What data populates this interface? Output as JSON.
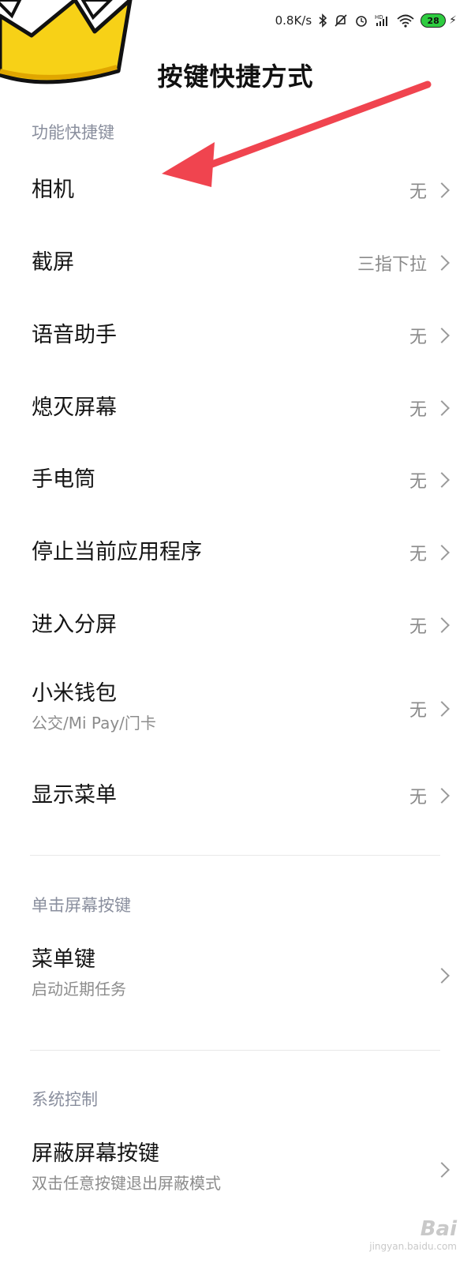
{
  "status_bar": {
    "net_speed": "0.8K/s",
    "battery": "28",
    "icons": [
      "bluetooth-icon",
      "mute-icon",
      "alarm-icon",
      "hd-signal-icon",
      "wifi-icon",
      "battery-icon",
      "charging-icon"
    ]
  },
  "page": {
    "title": "按键快捷方式"
  },
  "sections": [
    {
      "header": "功能快捷键",
      "items": [
        {
          "label": "相机",
          "value": "无"
        },
        {
          "label": "截屏",
          "value": "三指下拉"
        },
        {
          "label": "语音助手",
          "value": "无"
        },
        {
          "label": "熄灭屏幕",
          "value": "无"
        },
        {
          "label": "手电筒",
          "value": "无"
        },
        {
          "label": "停止当前应用程序",
          "value": "无"
        },
        {
          "label": "进入分屏",
          "value": "无"
        },
        {
          "label": "小米钱包",
          "sub": "公交/Mi Pay/门卡",
          "value": "无"
        },
        {
          "label": "显示菜单",
          "value": "无"
        }
      ]
    },
    {
      "header": "单击屏幕按键",
      "items": [
        {
          "label": "菜单键",
          "sub": "启动近期任务"
        }
      ]
    },
    {
      "header": "系统控制",
      "items": [
        {
          "label": "屏蔽屏幕按键",
          "sub": "双击任意按键退出屏蔽模式"
        }
      ]
    }
  ],
  "watermark": {
    "line1": "Bai",
    "line2": "jingyan.baidu.com"
  },
  "colors": {
    "arrow": "#f0444f",
    "crown": "#f7d117",
    "section_header": "#8a8f9e"
  }
}
